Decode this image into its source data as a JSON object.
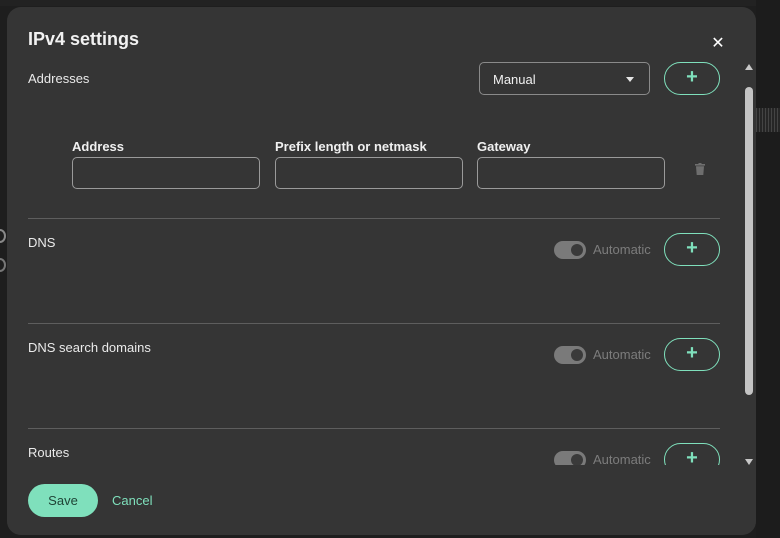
{
  "dialog": {
    "title": "IPv4 settings",
    "close_glyph": "✕"
  },
  "addresses": {
    "label": "Addresses",
    "method_value": "Manual",
    "add_glyph": "+",
    "columns": [
      "Address",
      "Prefix length or netmask",
      "Gateway"
    ],
    "row": {
      "address": "",
      "prefix": "",
      "gateway": ""
    }
  },
  "dns": {
    "label": "DNS",
    "toggle_label": "Automatic",
    "toggle_on": true,
    "add_glyph": "+"
  },
  "dns_search": {
    "label": "DNS search domains",
    "toggle_label": "Automatic",
    "toggle_on": true,
    "add_glyph": "+"
  },
  "routes": {
    "label": "Routes",
    "toggle_label": "Automatic",
    "toggle_on": true,
    "add_glyph": "+"
  },
  "footer": {
    "save_label": "Save",
    "cancel_label": "Cancel"
  },
  "icons": [
    "close-icon",
    "chevron-down-icon",
    "plus-icon",
    "trash-icon",
    "scroll-up-arrow",
    "scroll-down-arrow"
  ],
  "colors": {
    "accent": "#7fe0bc",
    "dialog_bg": "#353535",
    "page_bg": "#1e1e1e"
  }
}
